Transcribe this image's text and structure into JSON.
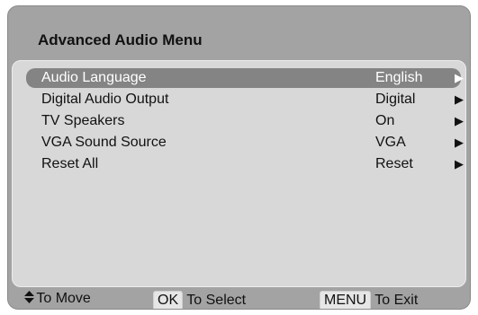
{
  "menu": {
    "title": "Advanced Audio Menu",
    "items": [
      {
        "label": "Audio Language",
        "value": "English",
        "arrow": "▶",
        "selected": true
      },
      {
        "label": "Digital Audio Output",
        "value": "Digital",
        "arrow": "▶",
        "selected": false
      },
      {
        "label": "TV Speakers",
        "value": "On",
        "arrow": "▶",
        "selected": false
      },
      {
        "label": "VGA Sound Source",
        "value": "VGA",
        "arrow": "▶",
        "selected": false
      },
      {
        "label": "Reset All",
        "value": "Reset",
        "arrow": "▶",
        "selected": false
      }
    ]
  },
  "footer": {
    "move_icon": "up-down-arrows-icon",
    "move_label": "To Move",
    "ok_key": "OK",
    "select_label": "To Select",
    "menu_key": "MENU",
    "exit_label": "To Exit"
  },
  "colors": {
    "background": "#a3a3a3",
    "panel": "#d8d8d8",
    "highlight": "#848484",
    "key": "#e6e6e6"
  }
}
